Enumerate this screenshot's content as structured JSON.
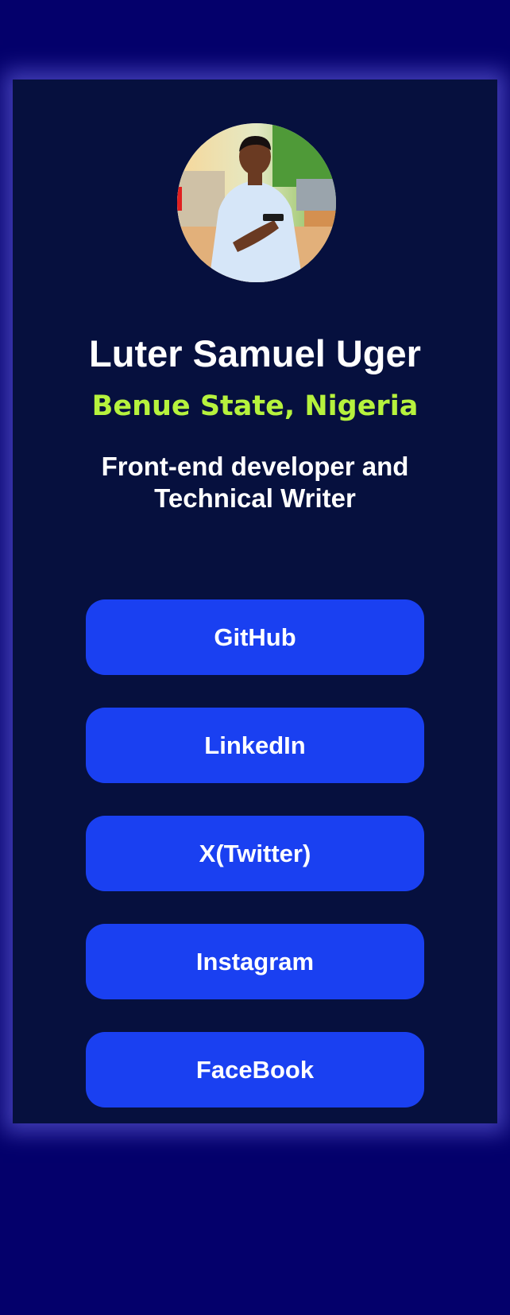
{
  "profile": {
    "name": "Luter Samuel Uger",
    "location": "Benue State, Nigeria",
    "tagline_line1": "Front-end developer and",
    "tagline_line2": "Technical Writer",
    "avatar_alt": "profile photo"
  },
  "links": [
    {
      "label": "GitHub"
    },
    {
      "label": "LinkedIn"
    },
    {
      "label": "X(Twitter)"
    },
    {
      "label": "Instagram"
    },
    {
      "label": "FaceBook"
    }
  ],
  "colors": {
    "page_background": "#04006b",
    "card_background": "#06103e",
    "accent_location": "#b6f23d",
    "button_background": "#1a40f1",
    "text": "#ffffff"
  }
}
